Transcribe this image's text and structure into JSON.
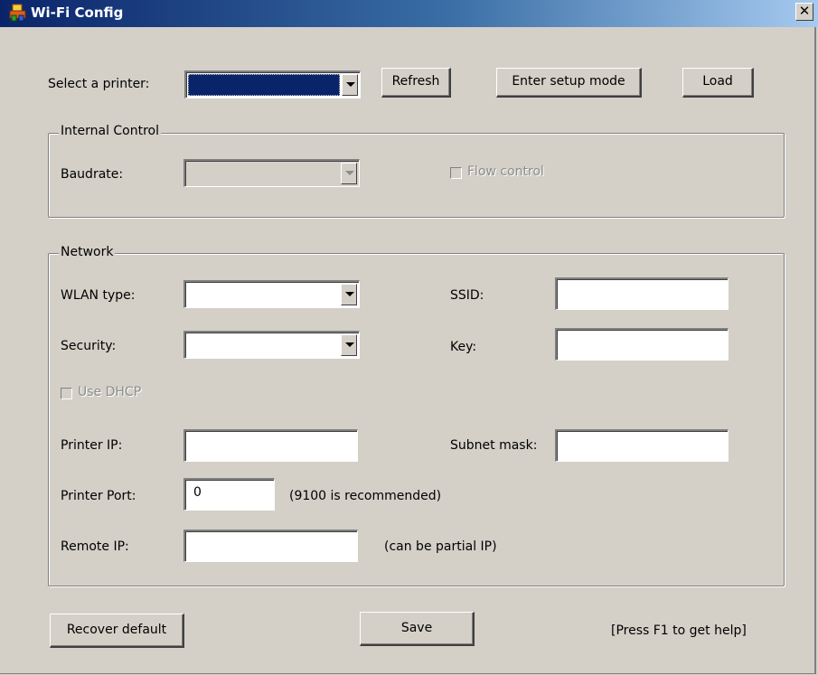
{
  "window": {
    "title": "Wi-Fi Config",
    "close_symbol": "✕",
    "titlebar_gradient": [
      "#0a246a",
      "#a6caf0"
    ],
    "icon": "printer-app-icon"
  },
  "top": {
    "select_printer_label": "Select a printer:",
    "printer_value": "",
    "refresh_label": "Refresh",
    "setup_mode_label": "Enter setup mode",
    "load_label": "Load"
  },
  "internal_control": {
    "title": "Internal Control",
    "baudrate_label": "Baudrate:",
    "baudrate_value": "",
    "flow_control_label": "Flow control",
    "flow_control_checked": false,
    "enabled": false
  },
  "network": {
    "title": "Network",
    "wlan_type_label": "WLAN type:",
    "wlan_type_value": "",
    "ssid_label": "SSID:",
    "ssid_value": "",
    "security_label": "Security:",
    "security_value": "",
    "key_label": "Key:",
    "key_value": "",
    "use_dhcp_label": "Use DHCP",
    "use_dhcp_checked": false,
    "printer_ip_label": "Printer IP:",
    "printer_ip_value": "",
    "subnet_mask_label": "Subnet mask:",
    "subnet_mask_value": "",
    "printer_port_label": "Printer Port:",
    "printer_port_value": "0",
    "printer_port_hint": "(9100 is recommended)",
    "remote_ip_label": "Remote IP:",
    "remote_ip_value": "",
    "remote_ip_hint": "(can be partial IP)"
  },
  "footer": {
    "recover_default_label": "Recover default",
    "save_label": "Save",
    "help_hint": "[Press F1 to get help]"
  },
  "colors": {
    "dialog_bg": "#d4d0c8",
    "selection": "#0a246a",
    "disabled_text": "#8c8c8c"
  }
}
